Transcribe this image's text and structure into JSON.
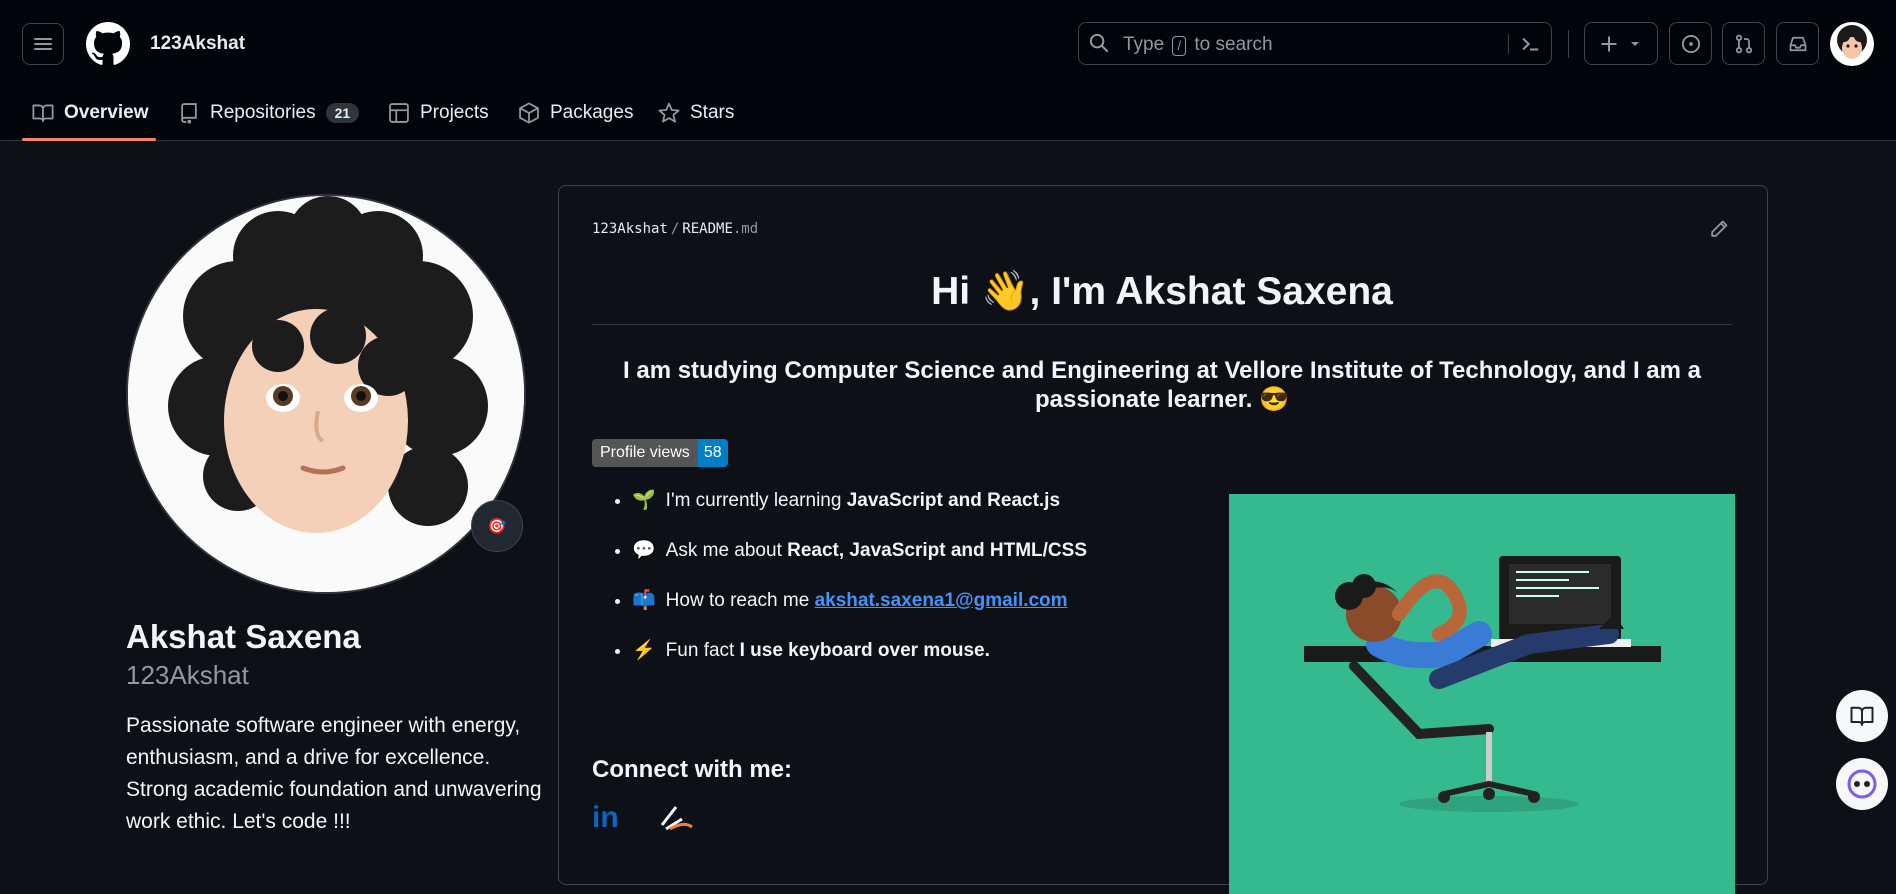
{
  "header": {
    "username": "123Akshat",
    "search": {
      "prefix": "Type",
      "key": "/",
      "suffix": "to search"
    }
  },
  "tabs": [
    {
      "label": "Overview",
      "icon": "book-icon"
    },
    {
      "label": "Repositories",
      "icon": "repo-icon",
      "count": "21"
    },
    {
      "label": "Projects",
      "icon": "table-icon"
    },
    {
      "label": "Packages",
      "icon": "package-icon"
    },
    {
      "label": "Stars",
      "icon": "star-icon"
    }
  ],
  "profile": {
    "name": "Akshat Saxena",
    "login": "123Akshat",
    "status_emoji": "🎯",
    "bio": "Passionate software engineer with energy, enthusiasm, and a drive for excellence. Strong academic foundation and unwavering work ethic. Let's code !!!"
  },
  "readme": {
    "owner": "123Akshat",
    "file": "README",
    "ext": ".md",
    "title": "Hi 👋, I'm Akshat Saxena",
    "lead": "I am studying Computer Science and Engineering at Vellore Institute of Technology, and I am a passionate learner. 😎",
    "profile_views": {
      "label": "Profile views",
      "count": "58"
    },
    "bullets": [
      {
        "emoji": "🌱",
        "text": "I'm currently learning ",
        "bold": "JavaScript and React.js"
      },
      {
        "emoji": "💬",
        "text": "Ask me about ",
        "bold": "React, JavaScript and HTML/CSS"
      },
      {
        "emoji": "📫",
        "text": "How to reach me ",
        "link": "akshat.saxena1@gmail.com"
      },
      {
        "emoji": "⚡",
        "text": "Fun fact ",
        "bold": "I use keyboard over mouse."
      }
    ],
    "connect_heading": "Connect with me:"
  },
  "colors": {
    "accent": "#f78166",
    "link": "#4493f8",
    "illustration_bg": "#35b98f"
  }
}
